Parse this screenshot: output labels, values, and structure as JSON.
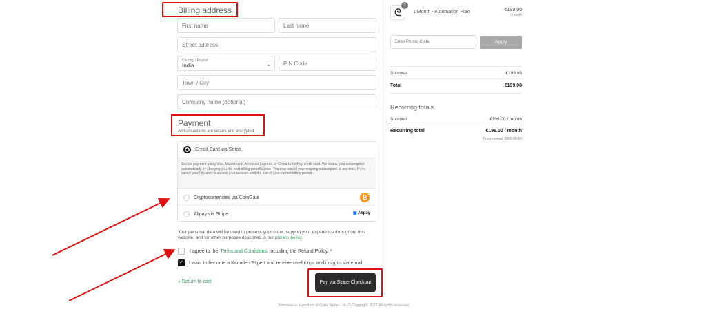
{
  "billing": {
    "title": "Billing address",
    "first_name_placeholder": "First name",
    "last_name_placeholder": "Last name",
    "street_placeholder": "Street address",
    "country_label": "Country / Region",
    "country_value": "India",
    "pin_placeholder": "PIN Code",
    "town_placeholder": "Town / City",
    "company_placeholder": "Company name (optional)"
  },
  "payment": {
    "title": "Payment",
    "subtitle": "All transactions are secure and encrypted",
    "methods": [
      {
        "label": "Credit Card via Stripe",
        "selected": true
      },
      {
        "label": "Cryptocurrencies via CoinGate",
        "selected": false,
        "badge": "₿"
      },
      {
        "label": "Alipay via Stripe",
        "selected": false,
        "badge": "Alipay"
      }
    ],
    "card_description": "Secure payment using Visa, Mastercard, American Express, or China UnionPay credit card. We renew your subscription automatically by charging you the next billing period's price. You may cancel your ongoing subscription at any time. If you cancel you'll be able to access your account until the end of your current billing period."
  },
  "privacy": {
    "text": "Your personal data will be used to process your order, support your experience throughout this website, and for other purposes described in our",
    "link": "privacy policy",
    "end": "."
  },
  "terms": {
    "prefix": "I agree to the",
    "link": "Terms and Conditions",
    "suffix": ", including the Refund Policy. *"
  },
  "newsletter": {
    "label": "I want to become a Kameleo Expert and receive useful tips and insights via email",
    "checked": true
  },
  "actions": {
    "return_label": "« Return to cart",
    "pay_label": "Pay via Stripe Checkout"
  },
  "footer": {
    "text": "Kameleo is a product of Outis Nemo Ltd. © Copyright 2023 All rights reserved."
  },
  "order": {
    "quantity": "1",
    "plan": "1 Month - Automation Plan",
    "price": "€199.00",
    "per": "/ month",
    "promo_placeholder": "Enter Promo Code",
    "apply_label": "Apply",
    "subtotal_label": "Subtotal",
    "subtotal_value": "€199.00",
    "total_label": "Total",
    "total_value": "€199.00",
    "recurring_title": "Recurring totals",
    "rec_subtotal_label": "Subtotal",
    "rec_subtotal_value": "€199.00 / month",
    "rec_total_label": "Recurring total",
    "rec_total_value": "€199.00 / month",
    "first_renewal": "First renewal: 2023-06-19"
  },
  "colors": {
    "accent_red": "#dd1111",
    "link_green": "#27a05b",
    "pay_bg": "#2b2b2b",
    "apply_bg": "#a9a9a9"
  }
}
